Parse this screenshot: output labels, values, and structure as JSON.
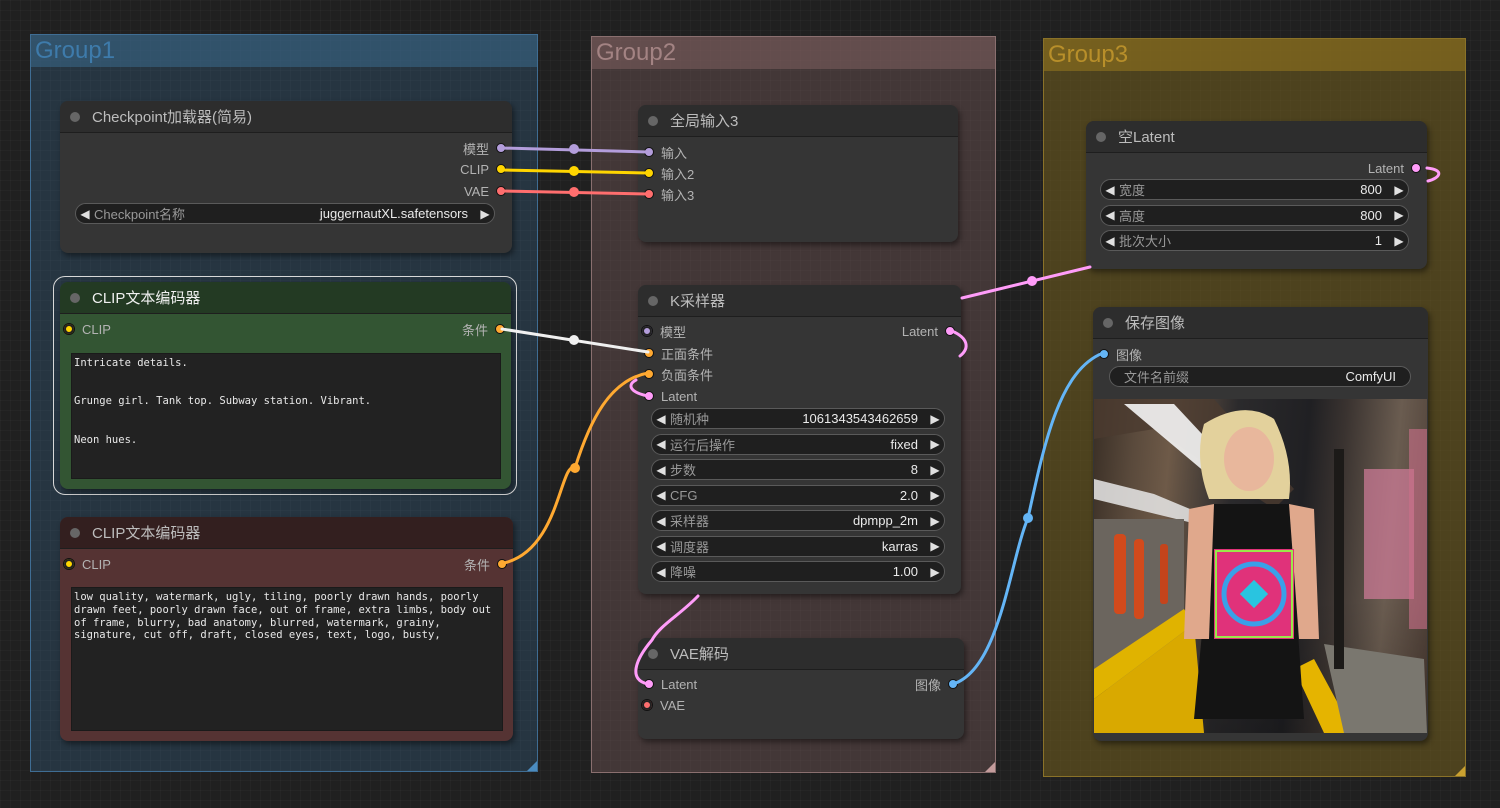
{
  "groups": [
    {
      "title": "Group1",
      "color": "#3f6d93"
    },
    {
      "title": "Group2",
      "color": "#8a6f6f"
    },
    {
      "title": "Group3",
      "color": "#b88f2a"
    }
  ],
  "nodes": {
    "checkpoint_loader": {
      "title": "Checkpoint加载器(简易)",
      "outputs": [
        {
          "label": "模型",
          "color": "#b39ddb"
        },
        {
          "label": "CLIP",
          "color": "#ffd500"
        },
        {
          "label": "VAE",
          "color": "#ff6e6e"
        }
      ],
      "widget": {
        "label": "Checkpoint名称",
        "value": "juggernautXL.safetensors"
      }
    },
    "clip_positive": {
      "title": "CLIP文本编码器",
      "input": {
        "label": "CLIP",
        "color": "#ffd500"
      },
      "output": {
        "label": "条件",
        "color": "#ffa931"
      },
      "text": "Intricate details.\n\n\nGrunge girl. Tank top. Subway station. Vibrant.\n\n\nNeon hues.",
      "color": "#335533"
    },
    "clip_negative": {
      "title": "CLIP文本编码器",
      "input": {
        "label": "CLIP",
        "color": "#ffd500"
      },
      "output": {
        "label": "条件",
        "color": "#ffa931"
      },
      "text": "low quality, watermark, ugly, tiling, poorly drawn hands, poorly drawn feet, poorly drawn face, out of frame, extra limbs, body out of frame, blurry, bad anatomy, blurred, watermark, grainy, signature, cut off, draft, closed eyes, text, logo, busty,",
      "color": "#553333"
    },
    "global_input": {
      "title": "全局输入3",
      "inputs": [
        {
          "label": "输入",
          "color": "#b39ddb"
        },
        {
          "label": "输入2",
          "color": "#ffd500"
        },
        {
          "label": "输入3",
          "color": "#ff6e6e"
        }
      ]
    },
    "ksampler": {
      "title": "K采样器",
      "inputs": [
        {
          "label": "模型",
          "color": "#b39ddb"
        },
        {
          "label": "正面条件",
          "color": "#ffa931"
        },
        {
          "label": "负面条件",
          "color": "#ffa931"
        },
        {
          "label": "Latent",
          "color": "#ff9cf9"
        }
      ],
      "output": {
        "label": "Latent",
        "color": "#ff9cf9"
      },
      "widgets": [
        {
          "label": "随机种",
          "value": "1061343543462659"
        },
        {
          "label": "运行后操作",
          "value": "fixed"
        },
        {
          "label": "步数",
          "value": "8"
        },
        {
          "label": "CFG",
          "value": "2.0"
        },
        {
          "label": "采样器",
          "value": "dpmpp_2m"
        },
        {
          "label": "调度器",
          "value": "karras"
        },
        {
          "label": "降噪",
          "value": "1.00"
        }
      ]
    },
    "vae_decode": {
      "title": "VAE解码",
      "inputs": [
        {
          "label": "Latent",
          "color": "#ff9cf9"
        },
        {
          "label": "VAE",
          "color": "#ff6e6e"
        }
      ],
      "output": {
        "label": "图像",
        "color": "#64b5f6"
      }
    },
    "empty_latent": {
      "title": "空Latent",
      "output": {
        "label": "Latent",
        "color": "#ff9cf9"
      },
      "widgets": [
        {
          "label": "宽度",
          "value": "800"
        },
        {
          "label": "高度",
          "value": "800"
        },
        {
          "label": "批次大小",
          "value": "1"
        }
      ]
    },
    "save_image": {
      "title": "保存图像",
      "input": {
        "label": "图像",
        "color": "#64b5f6"
      },
      "widget": {
        "label": "文件名前缀",
        "value": "ComfyUI"
      },
      "preview_alt": "Generated image: grunge girl in tank top at subway station"
    }
  }
}
